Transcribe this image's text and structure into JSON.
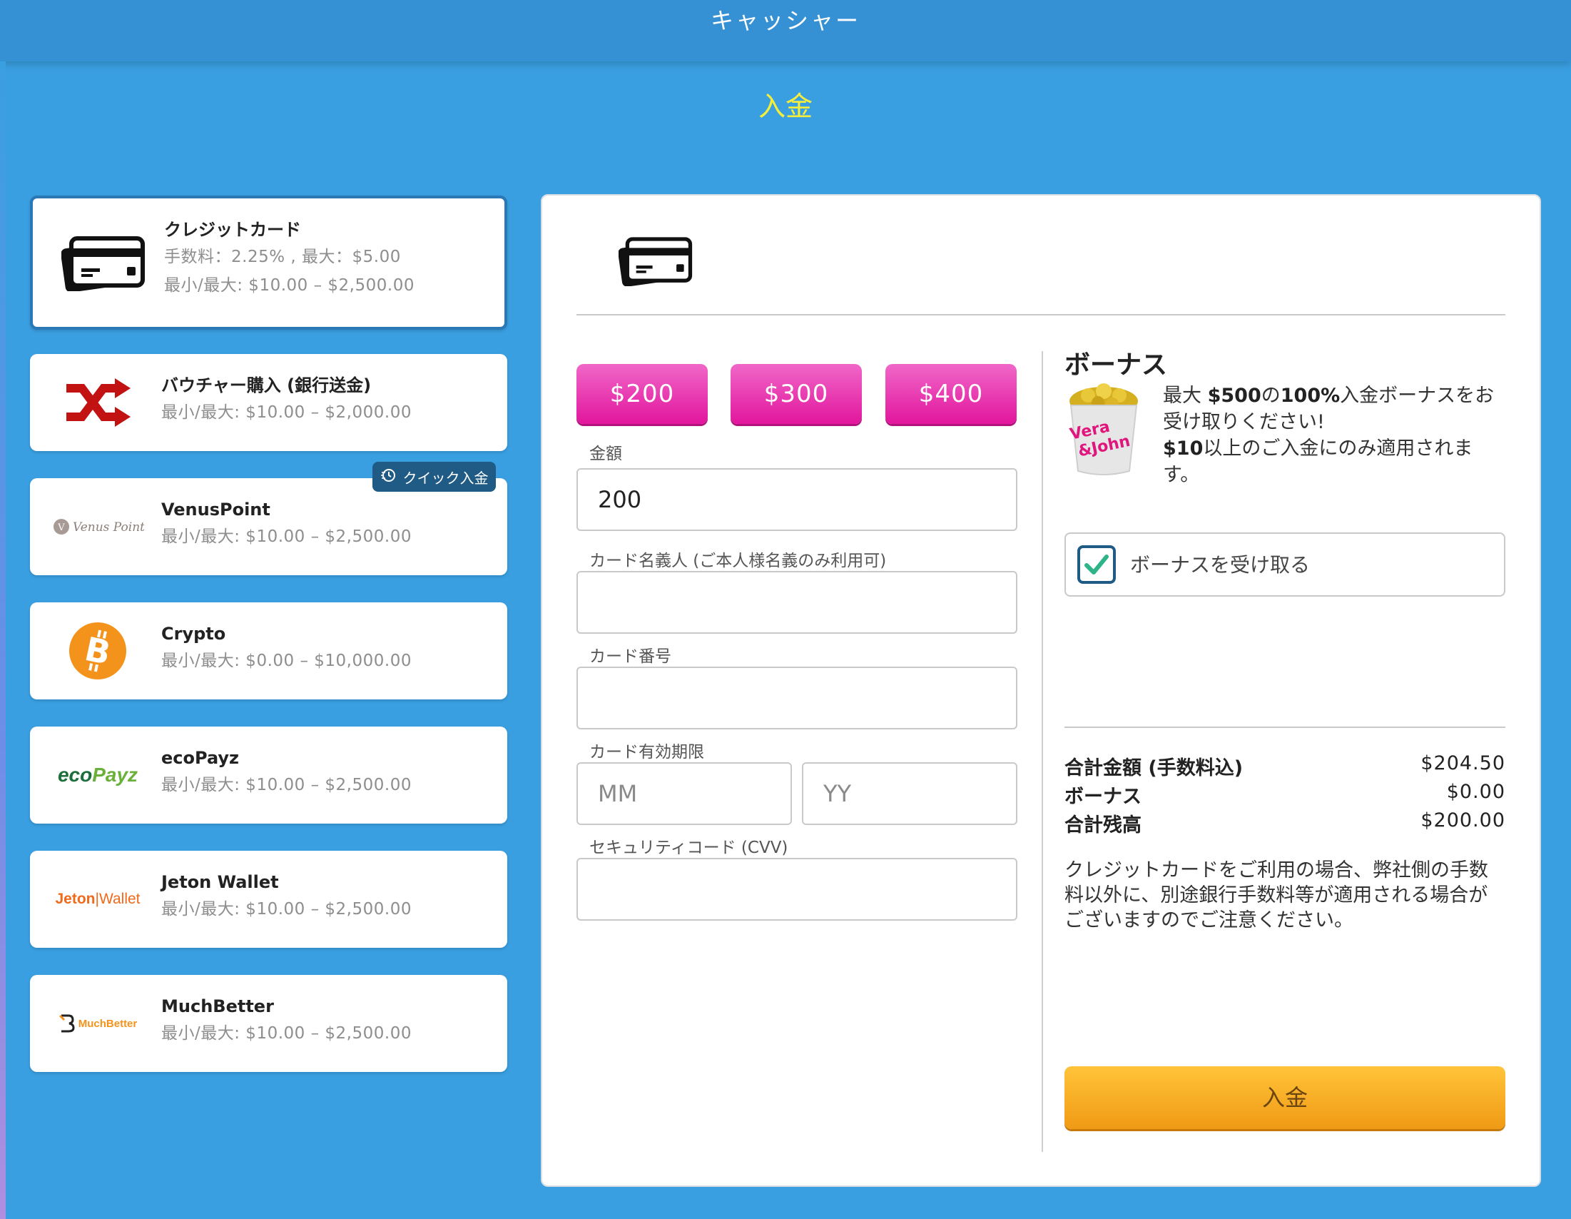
{
  "header": {
    "title": "キャッシャー"
  },
  "page": {
    "heading": "入金"
  },
  "methods": [
    {
      "name": "クレジットカード",
      "fee": "手数料：2.25% , 最大：$5.00",
      "limits": "最小/最大: $10.00 – $2,500.00",
      "icon": "credit-card-icon",
      "selected": true
    },
    {
      "name": "バウチャー購入 (銀行送金)",
      "limits": "最小/最大: $10.00 – $2,000.00",
      "icon": "shuffle-icon"
    },
    {
      "name": "VenusPoint",
      "limits": "最小/最大: $10.00 – $2,500.00",
      "icon": "venuspoint-logo",
      "logo_text": "Venus Point",
      "badge": "クイック入金"
    },
    {
      "name": "Crypto",
      "limits": "最小/最大: $0.00 – $10,000.00",
      "icon": "bitcoin-icon"
    },
    {
      "name": "ecoPayz",
      "limits": "最小/最大: $10.00 – $2,500.00",
      "icon": "ecopayz-logo",
      "logo_text_a": "eco",
      "logo_text_b": "Payz"
    },
    {
      "name": "Jeton Wallet",
      "limits": "最小/最大: $10.00 – $2,500.00",
      "icon": "jeton-logo",
      "logo_text_a": "Jeton",
      "logo_text_b": "Wallet"
    },
    {
      "name": "MuchBetter",
      "limits": "最小/最大: $10.00 – $2,500.00",
      "icon": "muchbetter-logo",
      "logo_text": "MuchBetter"
    }
  ],
  "form": {
    "amount_buttons": [
      "$200",
      "$300",
      "$400"
    ],
    "amount_label": "金額",
    "amount_value": "200",
    "cardholder_label": "カード名義人 (ご本人様名義のみ利用可)",
    "card_number_label": "カード番号",
    "expiry_label": "カード有効期限",
    "expiry_month_placeholder": "MM",
    "expiry_year_placeholder": "YY",
    "cvv_label": "セキュリティコード (CVV)"
  },
  "bonus": {
    "title": "ボーナス",
    "text_part1": "最大 ",
    "amount": "$500",
    "text_part2": "の",
    "percent": "100%",
    "text_part3": "入金ボーナスをお受け取りください!",
    "min": "$10",
    "text_part4": "以上のご入金にのみ適用されます。",
    "image_label_top": "Vera",
    "image_label_bottom": "&John",
    "checkbox_label": "ボーナスを受け取る",
    "checked": true
  },
  "summary": {
    "total_label": "合計金額 (手数料込)",
    "total_value": "$204.50",
    "bonus_label": "ボーナス",
    "bonus_value": "$0.00",
    "balance_label": "合計残高",
    "balance_value": "$200.00"
  },
  "notice": "クレジットカードをご利用の場合、弊社側の手数料以外に、別途銀行手数料等が適用される場合がございますのでご注意ください。",
  "deposit_button": "入金",
  "colors": {
    "background": "#3a9fe1",
    "heading": "#f7ee3a",
    "amount_button": "#e2169d",
    "deposit_button": "#f5a623",
    "badge": "#1f5b85"
  }
}
